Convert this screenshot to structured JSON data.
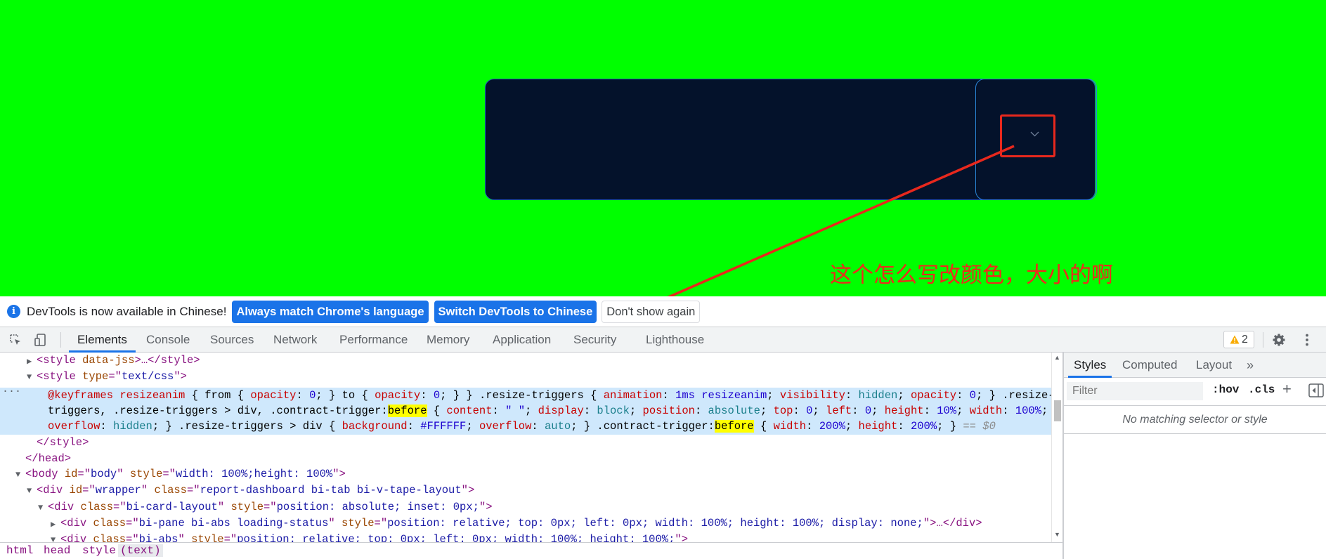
{
  "annotation": {
    "text": "这个怎么写改颜色，大小的啊"
  },
  "infobar": {
    "message": "DevTools is now available in Chinese!",
    "btn_match": "Always match Chrome's language",
    "btn_switch": "Switch DevTools to Chinese",
    "btn_dismiss": "Don't show again"
  },
  "tabs": [
    "Elements",
    "Console",
    "Sources",
    "Network",
    "Performance",
    "Memory",
    "Application",
    "Security",
    "Lighthouse"
  ],
  "warnings": {
    "count": "2"
  },
  "dom": {
    "l1": {
      "open": "<style",
      "attr": " data-jss",
      "mid": ">…</style>"
    },
    "l2": {
      "open": "<style",
      "attr": " type",
      "eq": "=\"",
      "val": "text/css",
      "close": "\">"
    },
    "css": {
      "a1": "@keyframes resizeanim",
      "a2": " { from { ",
      "a3": "opacity",
      "a4": ": ",
      "a5": "0",
      "a6": "; } to { ",
      "a7": "opacity",
      "a8": ": ",
      "a9": "0",
      "a10": "; } } .resize-triggers { ",
      "a11": "animation",
      "a12": ": ",
      "a13": "1ms resizeanim",
      "a14": "; ",
      "a15": "visibility",
      "a16": ": ",
      "a17": "hidden",
      "a18": "; ",
      "a19": "opacity",
      "a20": ": ",
      "a21": "0",
      "a22": "; } .resize-",
      "b1": "triggers, .resize-triggers > div, .contract-trigger:",
      "b2": "before",
      "b3": " { ",
      "b4": "content",
      "b5": ": ",
      "b6": "\" \"",
      "b7": "; ",
      "b8": "display",
      "b9": ": ",
      "b10": "block",
      "b11": "; ",
      "b12": "position",
      "b13": ": ",
      "b14": "absolute",
      "b15": "; ",
      "b16": "top",
      "b17": ": ",
      "b18": "0",
      "b19": "; ",
      "b20": "left",
      "b21": ": ",
      "b22": "0",
      "b23": "; ",
      "b24": "height",
      "b25": ": ",
      "b26": "10%",
      "b27": "; ",
      "b28": "width",
      "b29": ": ",
      "b30": "100%",
      "b31": ";",
      "c1": "overflow",
      "c2": ": ",
      "c3": "hidden",
      "c4": "; } .resize-triggers > div { ",
      "c5": "background",
      "c6": ": ",
      "c7": "#FFFFFF",
      "c8": "; ",
      "c9": "overflow",
      "c10": ": ",
      "c11": "auto",
      "c12": "; } .contract-trigger:",
      "c13": "before",
      "c14": " { ",
      "c15": "width",
      "c16": ": ",
      "c17": "200%",
      "c18": "; ",
      "c19": "height",
      "c20": ": ",
      "c21": "200%",
      "c22": "; } ",
      "c23": "== $0"
    },
    "l6": "</style>",
    "l7": "</head>",
    "l8": {
      "open": "<body",
      "a1": " id",
      "e1": "=\"",
      "v1": "body",
      "q1": "\"",
      "a2": " style",
      "e2": "=\"",
      "v2": "width: 100%;height: 100%",
      "close": "\">"
    },
    "l9": {
      "open": "<div",
      "a1": " id",
      "e1": "=\"",
      "v1": "wrapper",
      "q1": "\"",
      "a2": " class",
      "e2": "=\"",
      "v2": "report-dashboard bi-tab bi-v-tape-layout",
      "close": "\">"
    },
    "l10": {
      "open": "<div",
      "a1": " class",
      "e1": "=\"",
      "v1": "bi-card-layout",
      "q1": "\"",
      "a2": " style",
      "e2": "=\"",
      "v2": "position: absolute; inset: 0px;",
      "close": "\">"
    },
    "l11": {
      "open": "<div",
      "a1": " class",
      "e1": "=\"",
      "v1": "bi-pane bi-abs loading-status",
      "q1": "\"",
      "a2": " style",
      "e2": "=\"",
      "v2": "position: relative; top: 0px; left: 0px; width: 100%; height: 100%; display: none;",
      "close": "\">…</div>"
    },
    "l12": {
      "open": "<div",
      "a1": " class",
      "e1": "=\"",
      "v1": "bi-abs",
      "q1": "\"",
      "a2": " style",
      "e2": "=\"",
      "v2": "position: relative; top: 0px; left: 0px; width: 100%; height: 100%;",
      "close": "\">"
    }
  },
  "styles_panel": {
    "tabs": [
      "Styles",
      "Computed",
      "Layout"
    ],
    "filter_placeholder": "Filter",
    "hov": ":hov",
    "cls": ".cls",
    "empty": "No matching selector or style"
  },
  "breadcrumb": [
    "html",
    "head",
    "style",
    "(text)"
  ],
  "colors": {
    "page_bg": "#00ff00",
    "widget_bg": "#04122b",
    "accent": "#1a73e8",
    "annotation": "#e8281d"
  }
}
